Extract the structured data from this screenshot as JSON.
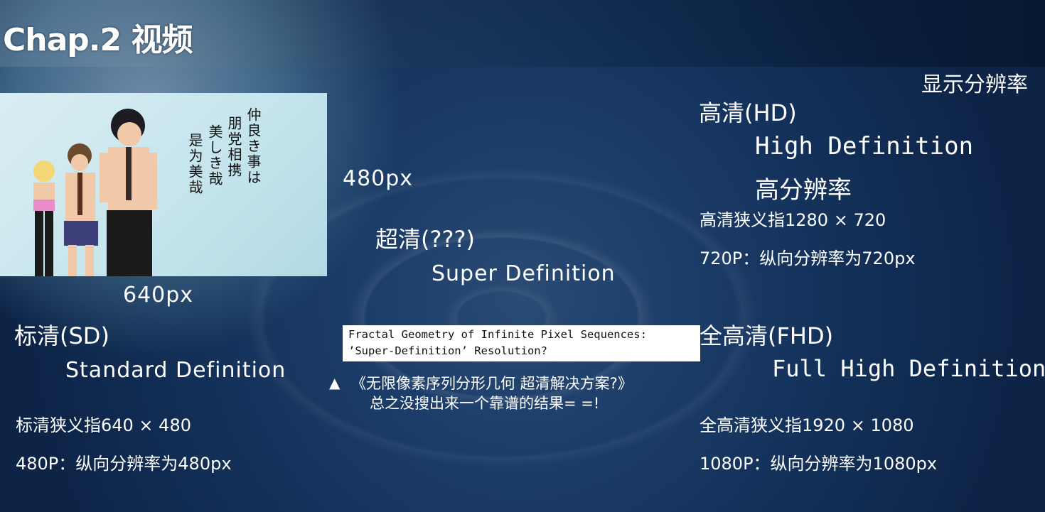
{
  "slide": {
    "title": "Chap.2 视频",
    "corner_label": "显示分辨率"
  },
  "thumbnail": {
    "vertical_text": [
      "仲良き事は",
      "朋党相携",
      "美しき哉",
      "是为美哉"
    ]
  },
  "sd": {
    "width_label": "640px",
    "height_label": "480px",
    "heading": "标清(SD)",
    "english": "Standard Definition",
    "resolution": "标清狭义指640 × 480",
    "progressive": "480P：纵向分辨率为480px"
  },
  "super": {
    "heading": "超清(???)",
    "english": "Super Definition",
    "box_line1": "Fractal Geometry of Infinite Pixel Sequences:",
    "box_line2": "’Super-Definition’ Resolution?",
    "arrow": "▲",
    "note_line1": "《无限像素序列分形几何 超清解决方案?》",
    "note_line2": "总之没搜出来一个靠谱的结果= =!"
  },
  "hd": {
    "heading": "高清(HD)",
    "english": "High Definition",
    "chinese": "高分辨率",
    "resolution": "高清狭义指1280 × 720",
    "progressive": "720P：纵向分辨率为720px"
  },
  "fhd": {
    "heading": "全高清(FHD)",
    "english": "Full High Definition",
    "resolution": "全高清狭义指1920 × 1080",
    "progressive": "1080P：纵向分辨率为1080px"
  },
  "colors": {
    "background": "#1c3d69",
    "text": "#ffffff",
    "note_box": "#ffffff"
  }
}
